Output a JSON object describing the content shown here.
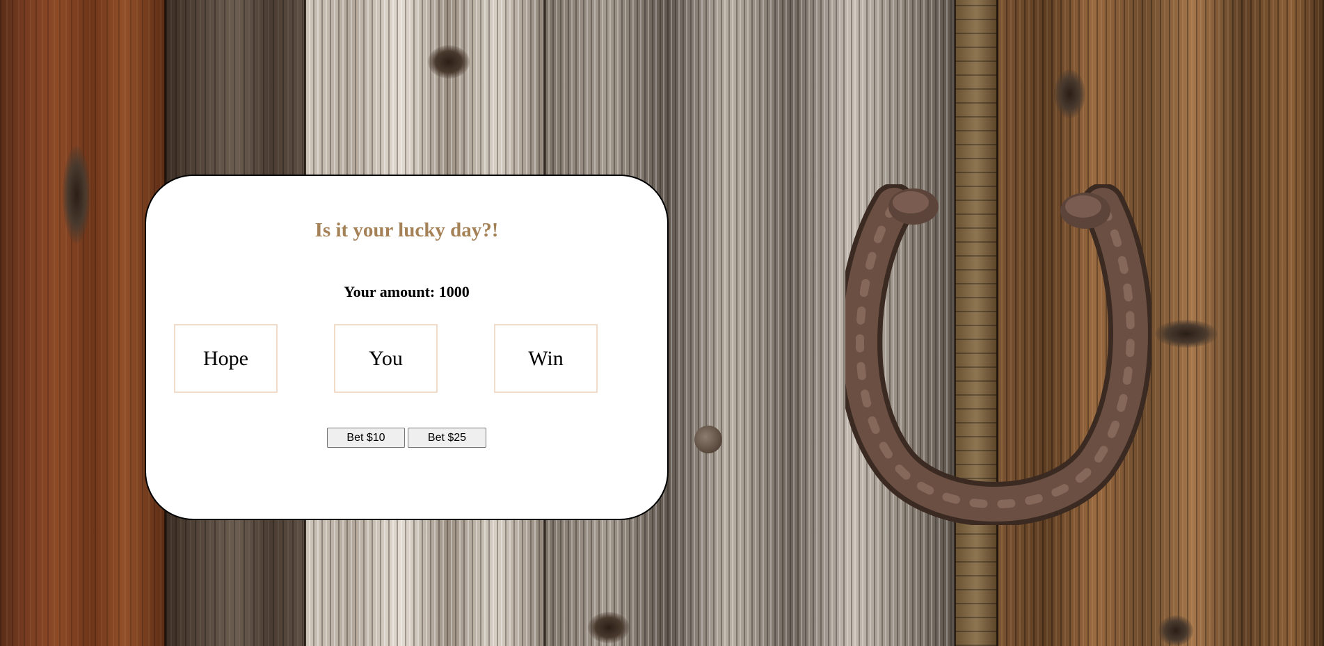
{
  "game": {
    "title": "Is it your lucky day?!",
    "amount_label": "Your amount: ",
    "amount_value": "1000",
    "slots": [
      "Hope",
      "You",
      "Win"
    ]
  },
  "bets": {
    "bet_10_label": "Bet $10",
    "bet_25_label": "Bet $25"
  },
  "theme": {
    "title_color": "#a48156",
    "slot_border_color": "#f0dcc9",
    "card_background": "#ffffff",
    "card_border": "#000000"
  },
  "background": {
    "icons": [
      "wooden-planks",
      "horseshoe-icon"
    ]
  }
}
